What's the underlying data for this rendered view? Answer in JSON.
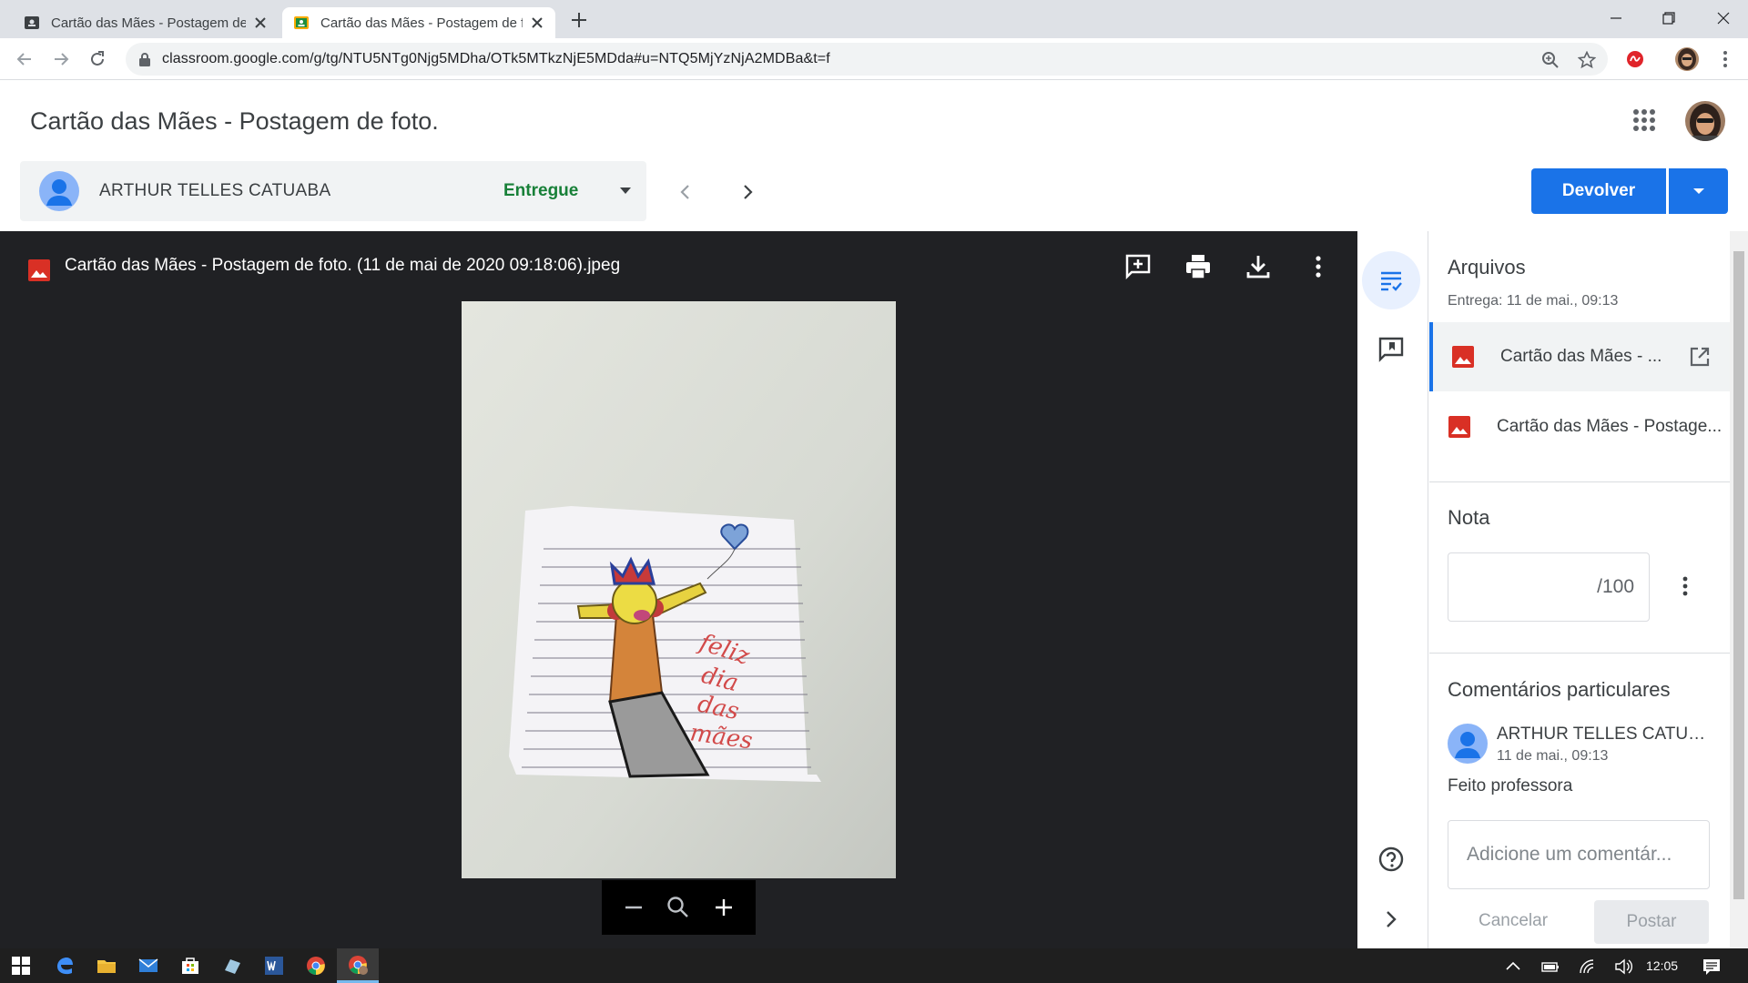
{
  "browser": {
    "tabs": [
      {
        "title": "Cartão das Mães - Postagem de foto."
      },
      {
        "title": "Cartão das Mães - Postagem de foto."
      }
    ],
    "url": "classroom.google.com/g/tg/NTU5NTg0Njg5MDha/OTk5MTkzNjE5MDda#u=NTQ5MjYzNjA2MDBa&t=f"
  },
  "header": {
    "title": "Cartão das Mães - Postagem de foto."
  },
  "student": {
    "name": "ARTHUR TELLES CATUABA",
    "status": "Entregue"
  },
  "actions": {
    "return_label": "Devolver"
  },
  "viewer": {
    "file_title": "Cartão das Mães - Postagem de foto. (11 de mai de 2020 09:18:06).jpeg",
    "drawing_text": [
      "feliz",
      "dia",
      "das",
      "mães"
    ]
  },
  "files_section": {
    "heading": "Arquivos",
    "submitted": "Entrega: 11 de mai., 09:13",
    "files": [
      {
        "name": "Cartão das Mães - ..."
      },
      {
        "name": "Cartão das Mães - Postage..."
      }
    ]
  },
  "grade_section": {
    "heading": "Nota",
    "out_of": "/100"
  },
  "comments_section": {
    "heading": "Comentários particulares",
    "comment": {
      "author": "ARTHUR TELLES CATUA...",
      "date": "11 de mai., 09:13",
      "text": "Feito professora"
    },
    "input_placeholder": "Adicione um comentár...",
    "cancel_label": "Cancelar",
    "post_label": "Postar"
  },
  "taskbar": {
    "clock": "12:05"
  },
  "colors": {
    "accent": "#1a73e8",
    "status_green": "#188038",
    "viewer_bg": "#202124",
    "file_red": "#d93025"
  }
}
